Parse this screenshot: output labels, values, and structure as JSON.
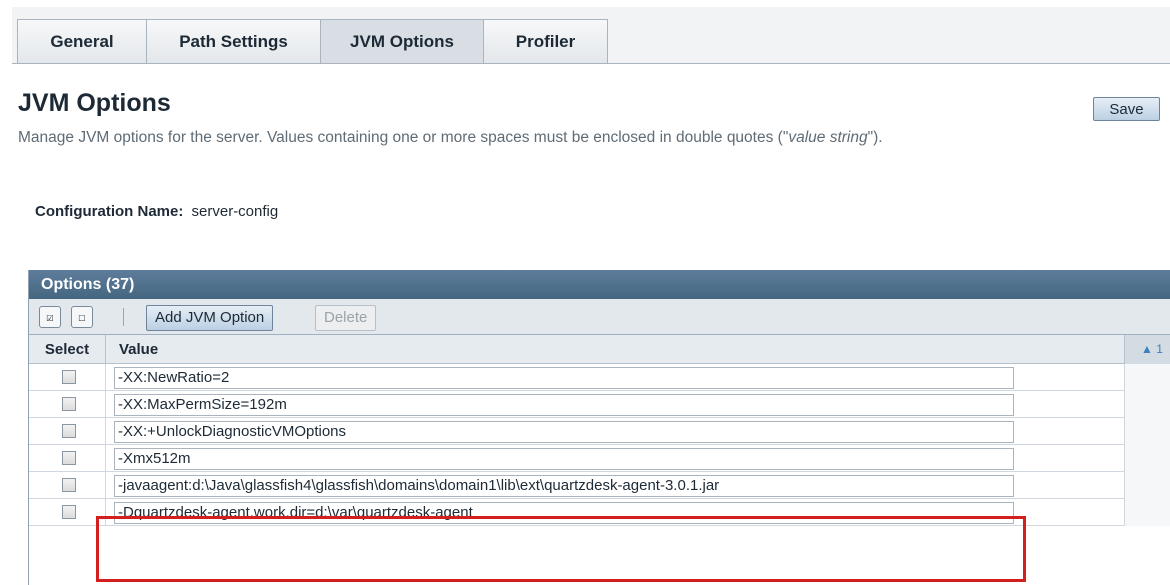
{
  "tabs": [
    {
      "label": "General",
      "active": false
    },
    {
      "label": "Path Settings",
      "active": false
    },
    {
      "label": "JVM Options",
      "active": true
    },
    {
      "label": "Profiler",
      "active": false
    }
  ],
  "page": {
    "title": "JVM Options",
    "save_label": "Save",
    "help_prefix": "Manage JVM options for the server. Values containing one or more spaces must be enclosed in double quotes (\"",
    "help_em": "value string",
    "help_suffix": "\")."
  },
  "config": {
    "label": "Configuration Name:",
    "value": "server-config"
  },
  "table": {
    "title": "Options (37)",
    "toolbar": {
      "select_all_icon": "select-all-icon",
      "deselect_all_icon": "deselect-all-icon",
      "add_label": "Add JVM Option",
      "delete_label": "Delete"
    },
    "columns": {
      "select": "Select",
      "value": "Value",
      "sort": "1"
    },
    "rows": [
      {
        "value": "-XX:NewRatio=2"
      },
      {
        "value": "-XX:MaxPermSize=192m"
      },
      {
        "value": "-XX:+UnlockDiagnosticVMOptions"
      },
      {
        "value": "-Xmx512m"
      },
      {
        "value": "-javaagent:d:\\Java\\glassfish4\\glassfish\\domains\\domain1\\lib\\ext\\quartzdesk-agent-3.0.1.jar"
      },
      {
        "value": "-Dquartzdesk-agent.work.dir=d:\\var\\quartzdesk-agent"
      }
    ]
  },
  "colors": {
    "table_header": "#4f7090",
    "highlight": "#d41f1f"
  }
}
